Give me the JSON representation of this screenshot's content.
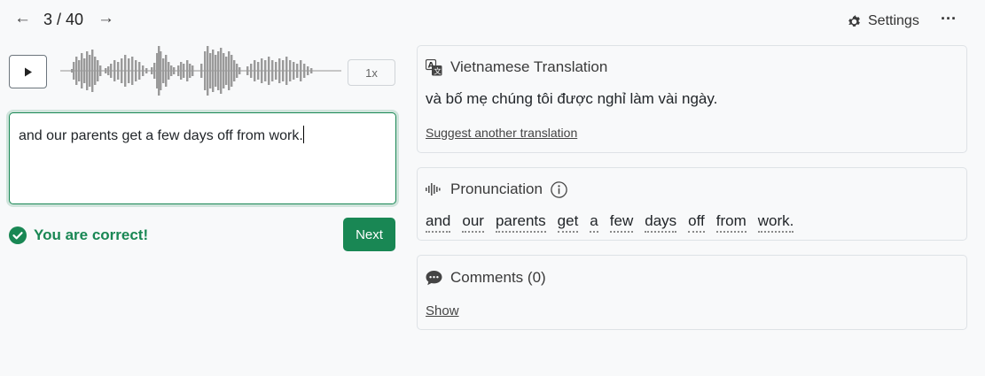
{
  "nav": {
    "prev_icon": "←",
    "counter": "3 / 40",
    "next_icon": "→",
    "settings_label": "Settings",
    "more_icon": "···"
  },
  "player": {
    "play_icon": "play-icon",
    "speed": "1x"
  },
  "answer": {
    "text": "and our parents get a few days off from work."
  },
  "feedback": {
    "message": "You are correct!",
    "next_label": "Next"
  },
  "translation": {
    "title": "Vietnamese Translation",
    "text": "và bố mẹ chúng tôi được nghỉ làm vài ngày.",
    "suggest_link": "Suggest another translation"
  },
  "pronunciation": {
    "title": "Pronunciation",
    "words": [
      "and",
      "our",
      "parents",
      "get",
      "a",
      "few",
      "days",
      "off",
      "from",
      "work."
    ]
  },
  "comments": {
    "title": "Comments (0)",
    "show_link": "Show"
  },
  "colors": {
    "success": "#198754",
    "background": "#f8f9fa",
    "border": "#dee2e6"
  }
}
